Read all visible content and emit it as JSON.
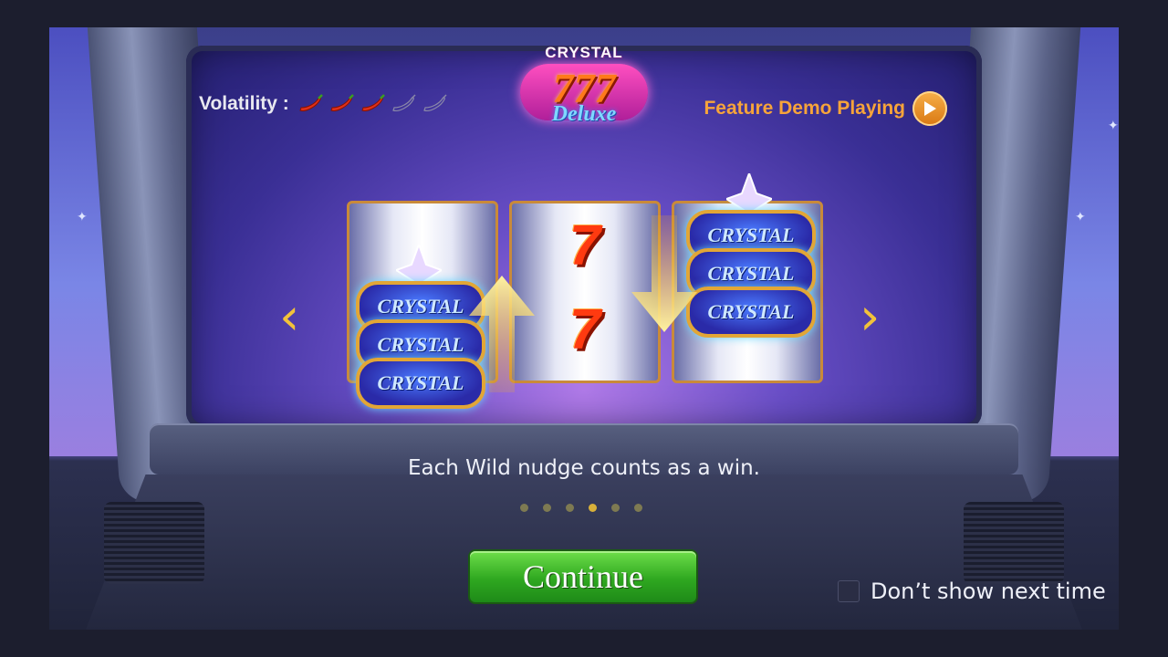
{
  "header": {
    "volatility_label": "Volatility :",
    "volatility_level": 3,
    "volatility_max": 5,
    "logo_top": "CRYSTAL",
    "logo_main": "777",
    "logo_sub": "Deluxe",
    "feature_demo_label": "Feature Demo Playing"
  },
  "reels": {
    "reel_1_symbol": "CRYSTAL",
    "reel_2_symbols": [
      "7",
      "7"
    ],
    "reel_3_symbol": "CRYSTAL"
  },
  "tutorial": {
    "caption": "Each Wild nudge counts as a win.",
    "page_current": 4,
    "page_total": 6
  },
  "footer": {
    "continue_label": "Continue",
    "dont_show_label": "Don’t show next time",
    "dont_show_checked": false
  },
  "colors": {
    "accent_orange": "#f7a43a",
    "button_green": "#2fa820",
    "nav_gold": "#f2c23a"
  },
  "icons": [
    "chili-pepper-icon",
    "play-icon",
    "chevron-left-icon",
    "chevron-right-icon",
    "arrow-up-icon",
    "arrow-down-icon",
    "crystal-icon"
  ]
}
